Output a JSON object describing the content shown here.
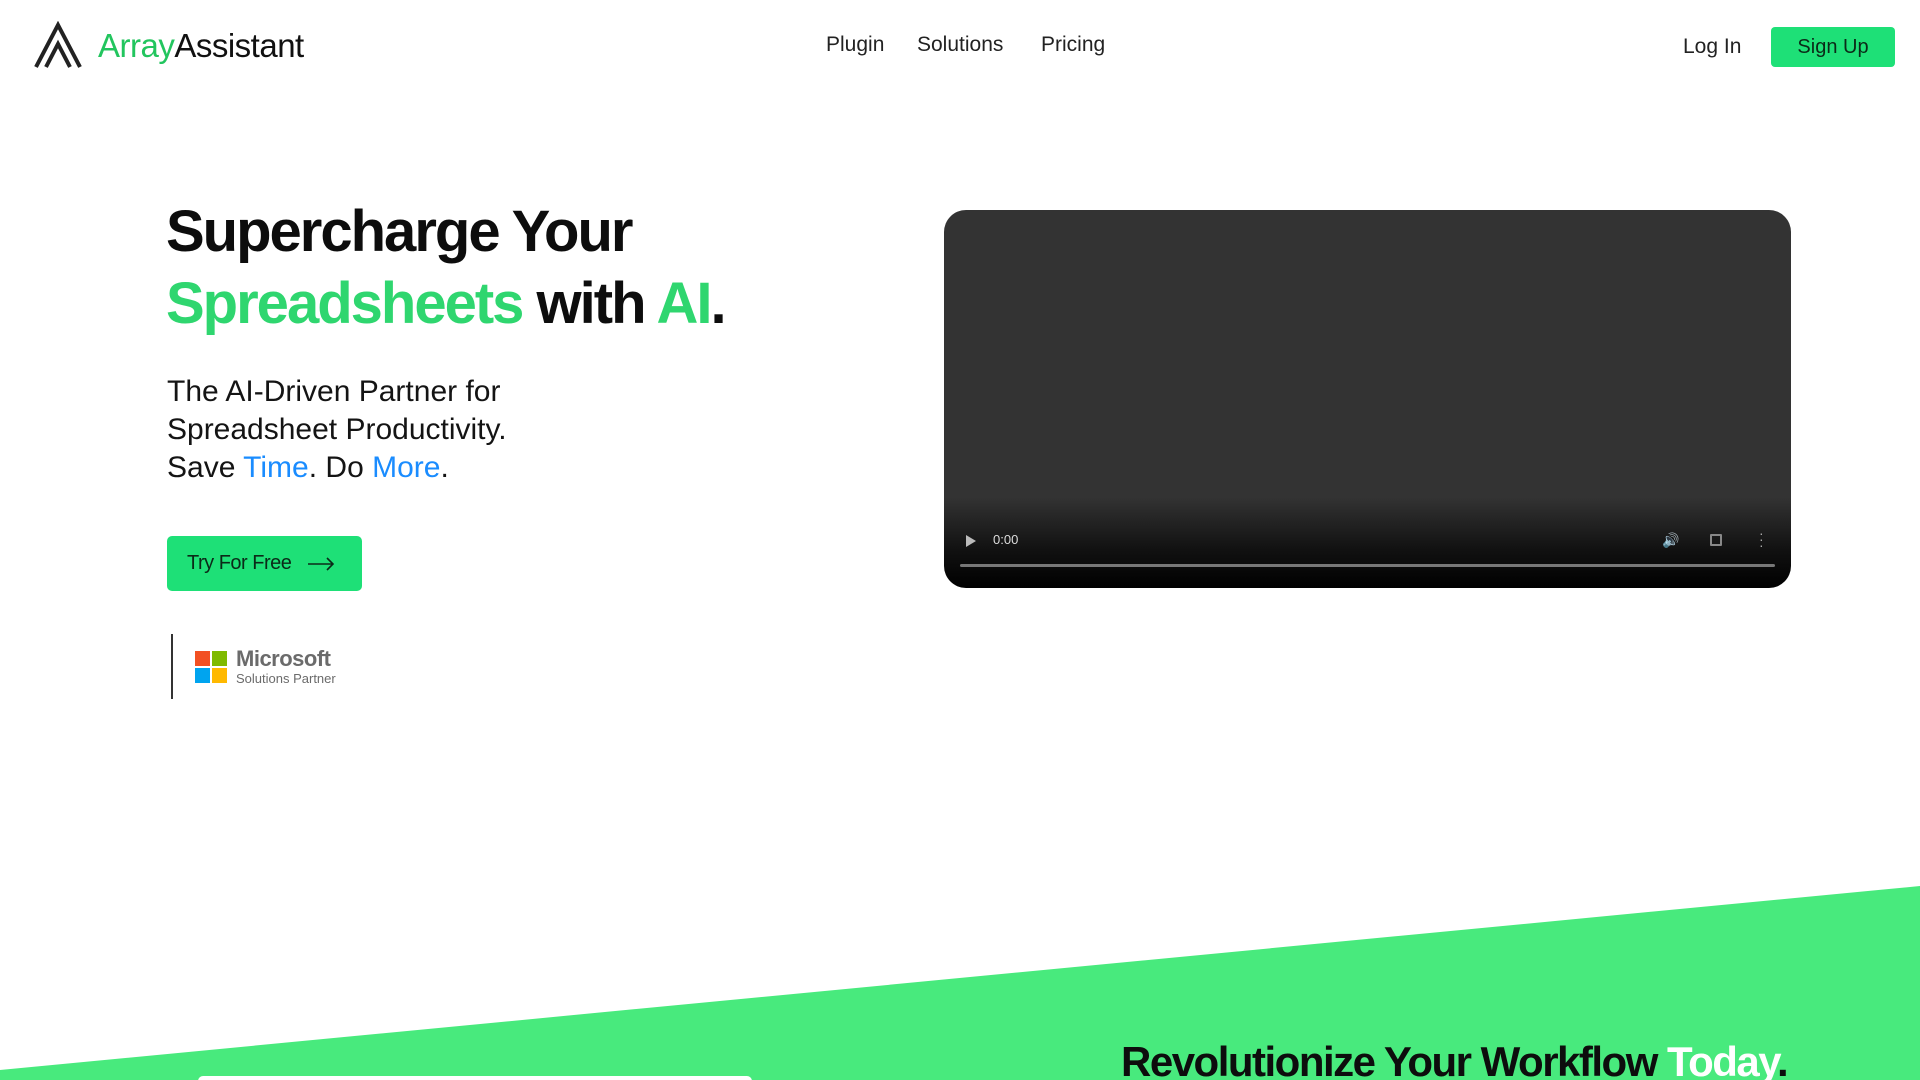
{
  "brand": {
    "name_accent": "Array",
    "name_rest": "Assistant",
    "accent_color": "#22c55e"
  },
  "nav": {
    "items": [
      {
        "label": "Plugin"
      },
      {
        "label": "Solutions"
      },
      {
        "label": "Pricing"
      }
    ],
    "login_label": "Log In",
    "signup_label": "Sign Up"
  },
  "hero": {
    "headline_line1": "Supercharge Your",
    "headline_word_green1": "Spreadsheets",
    "headline_with": " with ",
    "headline_word_green2": "AI",
    "headline_period": ".",
    "sub_line1": "The AI-Driven Partner for",
    "sub_line2": "Spreadsheet Productivity.",
    "sub_save": "Save ",
    "sub_time": "Time",
    "sub_do": ". Do ",
    "sub_more": "More",
    "sub_end": ".",
    "cta_label": "Try For Free",
    "cta_icon": "arrow-right-icon"
  },
  "partner": {
    "title": "Microsoft",
    "subtitle": "Solutions Partner",
    "logo_colors": [
      "#f25022",
      "#7fba00",
      "#00a4ef",
      "#ffb900"
    ]
  },
  "video": {
    "time": "0:00",
    "controls": [
      "play-icon",
      "volume-icon",
      "fullscreen-icon",
      "more-options-icon"
    ]
  },
  "section2": {
    "heading_main": "Revolutionize Your Workflow ",
    "heading_accent": "Today",
    "heading_end": ".",
    "band_color": "#48ea7d"
  }
}
